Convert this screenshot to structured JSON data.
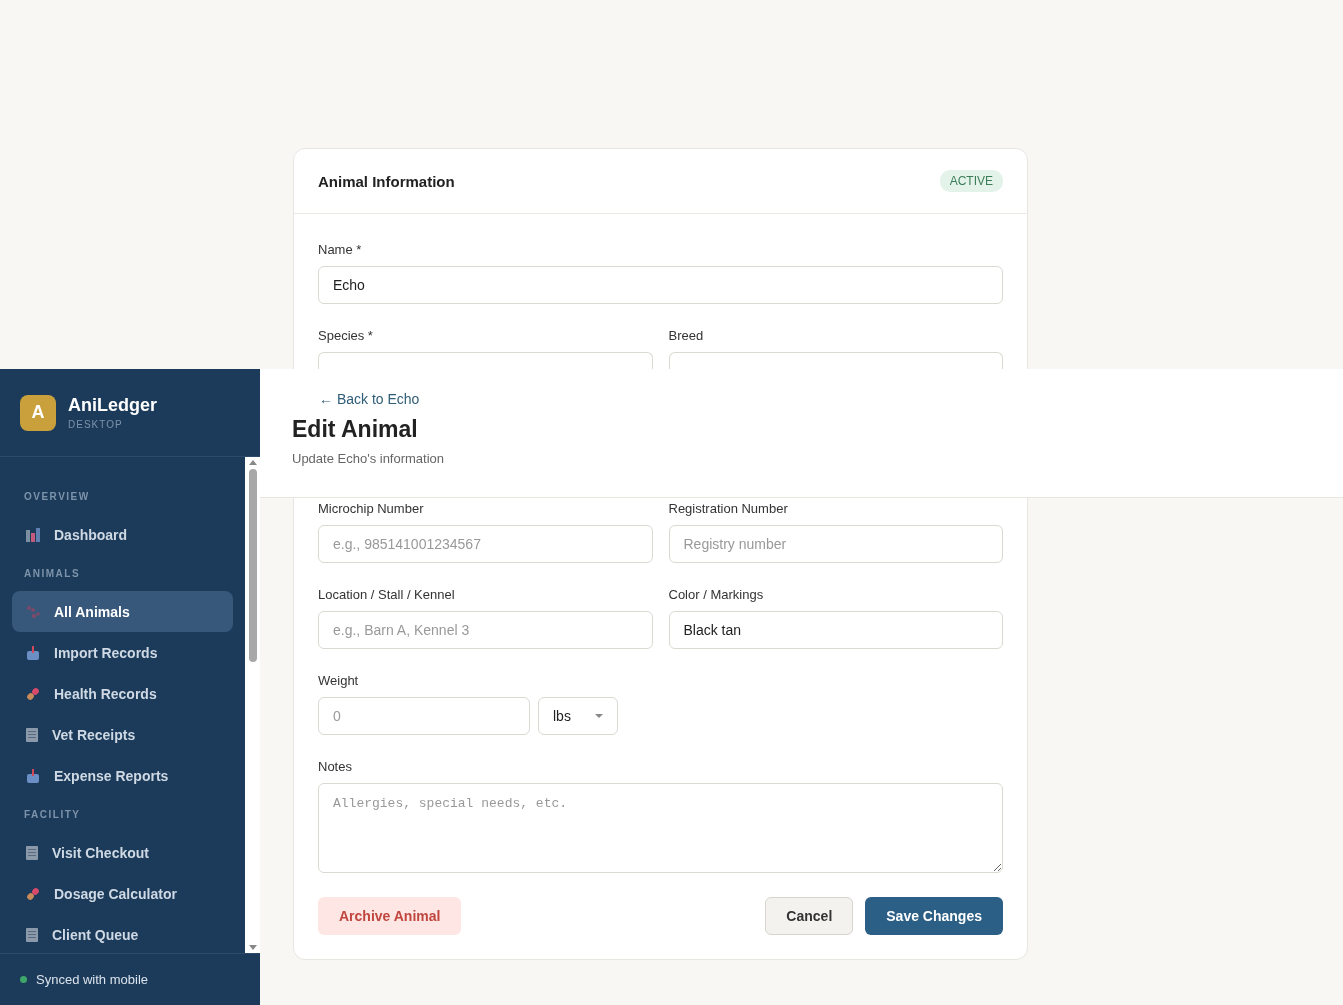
{
  "sidebar": {
    "app_name": "AniLedger",
    "app_subtitle": "DESKTOP",
    "logo_letter": "A",
    "sections": [
      {
        "title": "OVERVIEW",
        "items": [
          {
            "label": "Dashboard",
            "selected": false
          }
        ]
      },
      {
        "title": "ANIMALS",
        "items": [
          {
            "label": "All Animals",
            "selected": true
          },
          {
            "label": "Import Records",
            "selected": false
          },
          {
            "label": "Health Records",
            "selected": false
          },
          {
            "label": "Vet Receipts",
            "selected": false
          },
          {
            "label": "Expense Reports",
            "selected": false
          }
        ]
      },
      {
        "title": "FACILITY",
        "items": [
          {
            "label": "Visit Checkout",
            "selected": false
          },
          {
            "label": "Dosage Calculator",
            "selected": false
          },
          {
            "label": "Client Queue",
            "selected": false
          }
        ]
      }
    ],
    "sync_status": {
      "label": "Synced with mobile",
      "color": "#3fa66a"
    }
  },
  "header": {
    "back_link": "← Back to Echo",
    "title": "Edit Animal",
    "subtitle": "Update Echo's information"
  },
  "form": {
    "title": "Animal Information",
    "status": "ACTIVE",
    "rows": [
      [
        {
          "kind": "text",
          "label": "Name *",
          "value": "Echo"
        }
      ],
      [
        {
          "kind": "cut",
          "label": "Species *"
        },
        {
          "kind": "cut",
          "label": "Breed"
        }
      ],
      [
        {
          "kind": "text",
          "label": "Microchip Number",
          "placeholder": "e.g., 985141001234567"
        },
        {
          "kind": "text",
          "label": "Registration Number",
          "placeholder": "Registry number"
        }
      ],
      [
        {
          "kind": "text",
          "label": "Location / Stall / Kennel",
          "placeholder": "e.g., Barn A, Kennel 3"
        },
        {
          "kind": "text",
          "label": "Color / Markings",
          "value": "Black tan"
        }
      ],
      [
        {
          "kind": "weight",
          "label": "Weight",
          "placeholder": "0",
          "unit": "lbs"
        }
      ],
      [
        {
          "kind": "textarea",
          "label": "Notes",
          "placeholder": "Allergies, special needs, etc."
        }
      ]
    ],
    "buttons": [
      {
        "kind": "danger",
        "label": "Archive Animal"
      },
      {
        "kind": "secondary",
        "label": "Cancel"
      },
      {
        "kind": "primary",
        "label": "Save Changes"
      }
    ]
  }
}
